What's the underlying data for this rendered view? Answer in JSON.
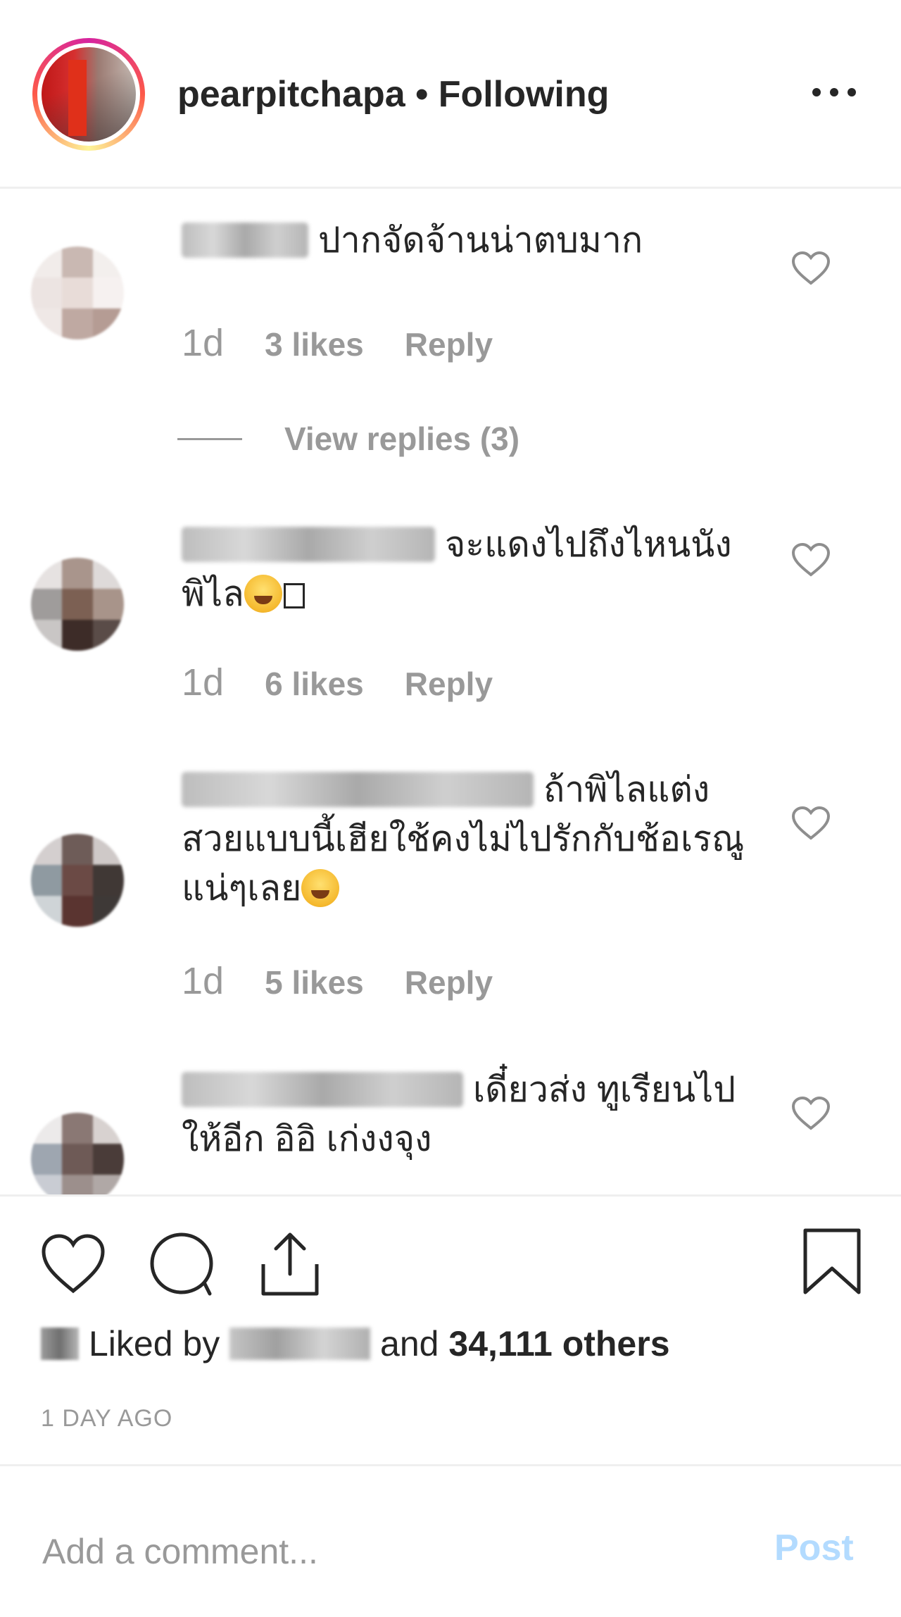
{
  "header": {
    "username": "pearpitchapa",
    "separator": "•",
    "follow_status": "Following",
    "more_icon": "ellipsis-icon"
  },
  "comments": [
    {
      "text": "ปากจัดจ้านน่าตบมาก",
      "age": "1d",
      "likes": "3 likes",
      "reply_label": "Reply",
      "view_replies": "View replies (3)"
    },
    {
      "text": "จะแดงไปถึงไหนนังพิไล",
      "emoji": "face-with-tears-of-joy",
      "age": "1d",
      "likes": "6 likes",
      "reply_label": "Reply"
    },
    {
      "text": "ถ้าพิไลแต่งสวยแบบนี้เฮียใช้คงไม่ไปรักกับช้อเรณูแน่ๆเลย",
      "emoji": "face-with-tears-of-joy",
      "age": "1d",
      "likes": "5 likes",
      "reply_label": "Reply"
    },
    {
      "text": "เดี๋ยวส่ง ทูเรียนไปให้อีก อิอิ เก่งงจุง"
    }
  ],
  "actions": {
    "icons": [
      "heart-icon",
      "comment-icon",
      "share-icon",
      "bookmark-icon"
    ]
  },
  "likes": {
    "prefix": "Liked by",
    "and": "and",
    "count_text": "34,111 others"
  },
  "timestamp": "1 DAY AGO",
  "add_comment": {
    "placeholder": "Add a comment...",
    "post_label": "Post"
  },
  "colors": {
    "text": "#262626",
    "muted": "#999999",
    "post_disabled": "#b3dbff",
    "divider": "#efefef"
  }
}
